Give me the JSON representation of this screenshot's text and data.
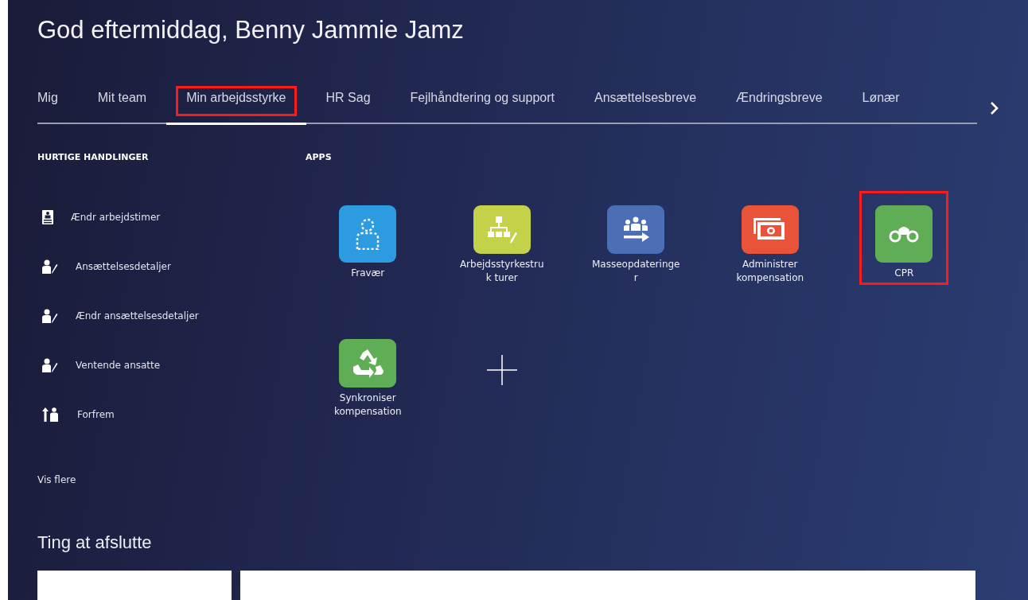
{
  "greeting": "God eftermiddag, Benny Jammie Jamz",
  "tabs": [
    {
      "label": "Mig",
      "selected": false,
      "highlighted": false
    },
    {
      "label": "Mit team",
      "selected": false,
      "highlighted": false
    },
    {
      "label": "Min arbejdsstyrke",
      "selected": true,
      "highlighted": true
    },
    {
      "label": "HR Sag",
      "selected": false,
      "highlighted": false
    },
    {
      "label": "Fejlhåndtering og support",
      "selected": false,
      "highlighted": false
    },
    {
      "label": "Ansættelsesbreve",
      "selected": false,
      "highlighted": false
    },
    {
      "label": "Ændringsbreve",
      "selected": false,
      "highlighted": false
    },
    {
      "label": "Lønær",
      "selected": false,
      "highlighted": false
    }
  ],
  "quick_actions": {
    "heading": "HURTIGE HANDLINGER",
    "items": [
      {
        "label": "Ændr arbejdstimer",
        "kind": "badge"
      },
      {
        "label": "Ansættelsesdetaljer",
        "kind": "edit"
      },
      {
        "label": "Ændr ansættelsesdetaljer",
        "kind": "edit"
      },
      {
        "label": "Ventende ansatte",
        "kind": "edit"
      },
      {
        "label": "Forfrem",
        "kind": "promote"
      }
    ],
    "more": "Vis flere"
  },
  "apps": {
    "heading": "APPS",
    "items": [
      {
        "label": "Fravær",
        "kind": "absence",
        "color": "#2d9be0",
        "highlighted": false
      },
      {
        "label": "Arbejdsstyrkestruk turer",
        "kind": "structure",
        "color": "#c4d24a",
        "highlighted": false
      },
      {
        "label": "Masseopdateringe r",
        "kind": "mass",
        "color": "#4a6fb5",
        "highlighted": false
      },
      {
        "label": "Administrer kompensation",
        "kind": "money",
        "color": "#e8533a",
        "highlighted": false
      },
      {
        "label": "CPR",
        "kind": "binoculars",
        "color": "#5fae55",
        "highlighted": true
      },
      {
        "label": "Synkroniser kompensation",
        "kind": "recycle",
        "color": "#5fae55",
        "highlighted": false
      }
    ]
  },
  "things_to_finish": {
    "title": "Ting at afslutte"
  }
}
